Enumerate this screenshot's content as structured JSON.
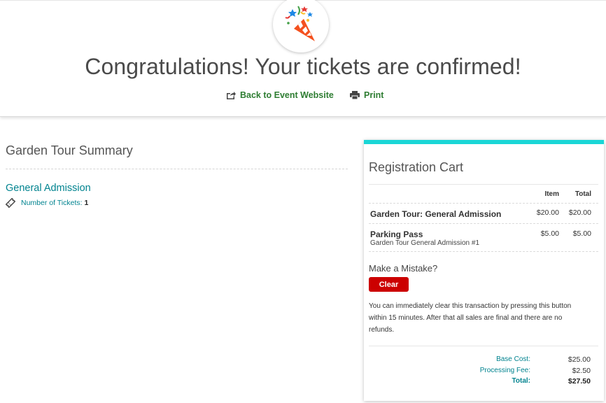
{
  "header": {
    "title": "Congratulations! Your tickets are confirmed!",
    "icon": "party-popper-icon",
    "back_link": "Back to Event Website",
    "print_link": "Print"
  },
  "summary": {
    "title": "Garden Tour Summary",
    "admission_title": "General Admission",
    "tickets_label": "Number of Tickets:",
    "tickets_count": "1"
  },
  "cart": {
    "title": "Registration Cart",
    "col_item": "Item",
    "col_total": "Total",
    "rows": [
      {
        "name": "Garden Tour: General Admission",
        "sub": "",
        "item": "$20.00",
        "total": "$20.00"
      },
      {
        "name": "Parking Pass",
        "sub": "Garden Tour General Admission #1",
        "item": "$5.00",
        "total": "$5.00"
      }
    ],
    "mistake_label": "Make a Mistake?",
    "clear_button": "Clear",
    "clear_note": "You can immediately clear this transaction by pressing this button within 15 minutes. After that all sales are final and there are no refunds.",
    "base_cost_label": "Base Cost:",
    "base_cost": "$25.00",
    "processing_fee_label": "Processing Fee:",
    "processing_fee": "$2.50",
    "total_label": "Total:",
    "total": "$27.50"
  },
  "colors": {
    "accent_teal": "#00838f",
    "link_green": "#2e7d32",
    "cart_top_bar": "#1ad6d6",
    "clear_red": "#cc0000"
  }
}
